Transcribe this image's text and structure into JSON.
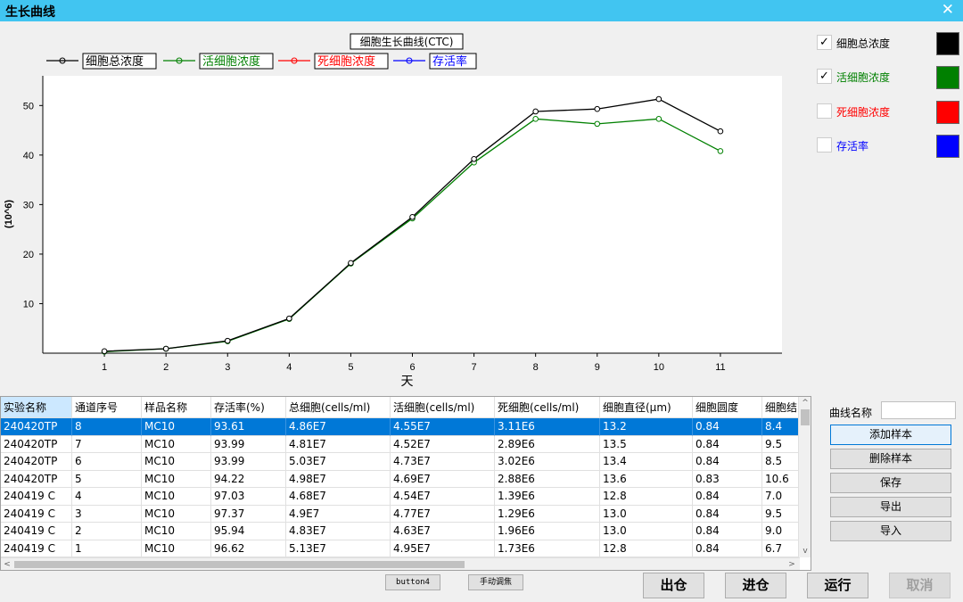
{
  "window": {
    "title": "生长曲线",
    "close_glyph": "✕"
  },
  "chart_data": {
    "type": "line",
    "title": "细胞生长曲线(CTC)",
    "xlabel": "天",
    "ylabel": "(10^6)",
    "x": [
      1,
      2,
      3,
      4,
      5,
      6,
      7,
      8,
      9,
      10,
      11
    ],
    "xlim": [
      0,
      12
    ],
    "ylim": [
      0,
      56
    ],
    "yticks": [
      10,
      20,
      30,
      40,
      50
    ],
    "grid": false,
    "legend_position": "top-left",
    "series": [
      {
        "name": "细胞总浓度",
        "color": "#000000",
        "values": [
          0.4,
          0.9,
          2.5,
          7.0,
          18.2,
          27.5,
          39.2,
          48.8,
          49.3,
          51.3,
          44.8
        ]
      },
      {
        "name": "活细胞浓度",
        "color": "#008000",
        "values": [
          0.3,
          0.9,
          2.4,
          6.9,
          18.1,
          27.2,
          38.5,
          47.3,
          46.3,
          47.3,
          40.8
        ]
      },
      {
        "name": "死细胞浓度",
        "color": "#ff0000",
        "values": []
      },
      {
        "name": "存活率",
        "color": "#0000ff",
        "values": []
      }
    ]
  },
  "curve_options": [
    {
      "label": "细胞总浓度",
      "checked": true,
      "check_glyph": "✓",
      "color": "#000000",
      "text_color": "#000000"
    },
    {
      "label": "活细胞浓度",
      "checked": true,
      "check_glyph": "✓",
      "color": "#008000",
      "text_color": "#008000"
    },
    {
      "label": "死细胞浓度",
      "checked": false,
      "check_glyph": "",
      "color": "#ff0000",
      "text_color": "#ff0000"
    },
    {
      "label": "存活率",
      "checked": false,
      "check_glyph": "",
      "color": "#0000ff",
      "text_color": "#0000ff"
    }
  ],
  "table": {
    "columns": [
      "实验名称",
      "通道序号",
      "样品名称",
      "存活率(%)",
      "总细胞(cells/ml)",
      "活细胞(cells/ml)",
      "死细胞(cells/ml)",
      "细胞直径(μm)",
      "细胞圆度",
      "细胞结"
    ],
    "rows": [
      [
        "240420TP",
        "8",
        "MC10",
        "93.61",
        "4.86E7",
        "4.55E7",
        "3.11E6",
        "13.2",
        "0.84",
        "8.4"
      ],
      [
        "240420TP",
        "7",
        "MC10",
        "93.99",
        "4.81E7",
        "4.52E7",
        "2.89E6",
        "13.5",
        "0.84",
        "9.5"
      ],
      [
        "240420TP",
        "6",
        "MC10",
        "93.99",
        "5.03E7",
        "4.73E7",
        "3.02E6",
        "13.4",
        "0.84",
        "8.5"
      ],
      [
        "240420TP",
        "5",
        "MC10",
        "94.22",
        "4.98E7",
        "4.69E7",
        "2.88E6",
        "13.6",
        "0.83",
        "10.6"
      ],
      [
        "240419 C",
        "4",
        "MC10",
        "97.03",
        "4.68E7",
        "4.54E7",
        "1.39E6",
        "12.8",
        "0.84",
        "7.0"
      ],
      [
        "240419 C",
        "3",
        "MC10",
        "97.37",
        "4.9E7",
        "4.77E7",
        "1.29E6",
        "13.0",
        "0.84",
        "9.5"
      ],
      [
        "240419 C",
        "2",
        "MC10",
        "95.94",
        "4.83E7",
        "4.63E7",
        "1.96E6",
        "13.0",
        "0.84",
        "9.0"
      ],
      [
        "240419 C",
        "1",
        "MC10",
        "96.62",
        "5.13E7",
        "4.95E7",
        "1.73E6",
        "12.8",
        "0.84",
        "6.7"
      ]
    ],
    "selected_row": 0
  },
  "scroll": {
    "up": "^",
    "down": "v",
    "left": "<",
    "right": ">"
  },
  "side": {
    "name_label": "曲线名称",
    "name_value": "",
    "add_sample": "添加样本",
    "delete_sample": "删除样本",
    "save": "保存",
    "export": "导出",
    "import": "导入"
  },
  "bottom": {
    "button4": "button4",
    "manual_focus": "手动调焦",
    "out": "出仓",
    "in": "进仓",
    "run": "运行",
    "cancel": "取消"
  }
}
